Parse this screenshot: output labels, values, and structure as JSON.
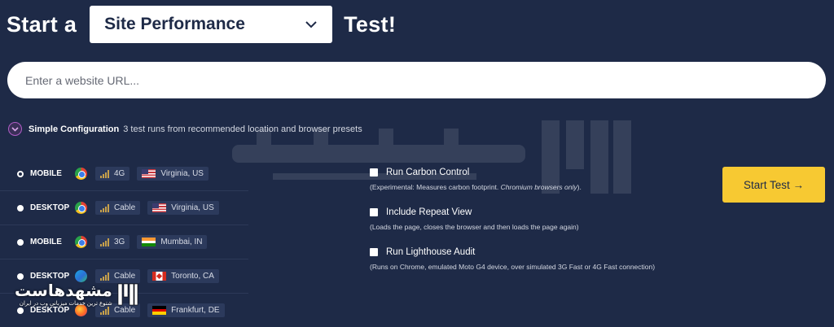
{
  "header": {
    "prefix": "Start a",
    "test_type": "Site Performance",
    "suffix": "Test!"
  },
  "url_input": {
    "placeholder": "Enter a website URL...",
    "value": ""
  },
  "simple_config": {
    "title": "Simple Configuration",
    "description": "3 test runs from recommended location and browser presets"
  },
  "presets": [
    {
      "device": "MOBILE",
      "browser": "chrome",
      "connection": "4G",
      "location": "Virginia, US",
      "flag": "us",
      "selected": true
    },
    {
      "device": "DESKTOP",
      "browser": "chrome",
      "connection": "Cable",
      "location": "Virginia, US",
      "flag": "us",
      "selected": false
    },
    {
      "device": "MOBILE",
      "browser": "chrome",
      "connection": "3G",
      "location": "Mumbai, IN",
      "flag": "in",
      "selected": false
    },
    {
      "device": "DESKTOP",
      "browser": "edge",
      "connection": "Cable",
      "location": "Toronto, CA",
      "flag": "ca",
      "selected": false
    },
    {
      "device": "DESKTOP",
      "browser": "firefox",
      "connection": "Cable",
      "location": "Frankfurt, DE",
      "flag": "de",
      "selected": false
    }
  ],
  "options": [
    {
      "title": "Run Carbon Control",
      "desc_prefix": "(Experimental: Measures carbon footprint. ",
      "desc_em": "Chromium browsers only",
      "desc_suffix": ")."
    },
    {
      "title": "Include Repeat View",
      "desc_prefix": "(Loads the page, closes the browser and then loads the page again)",
      "desc_em": "",
      "desc_suffix": ""
    },
    {
      "title": "Run Lighthouse Audit",
      "desc_prefix": "(Runs on Chrome, emulated Moto G4 device, over simulated 3G Fast or 4G Fast connection)",
      "desc_em": "",
      "desc_suffix": ""
    }
  ],
  "start_button": {
    "label": "Start Test →"
  },
  "watermark": {
    "brand": "مشهدهاست",
    "tagline": "شتوع ترین خدمات میزبانی وب در ایران"
  },
  "colors": {
    "background": "#1e2a47",
    "accent": "#f7c932",
    "toggle": "#b05cc6"
  }
}
